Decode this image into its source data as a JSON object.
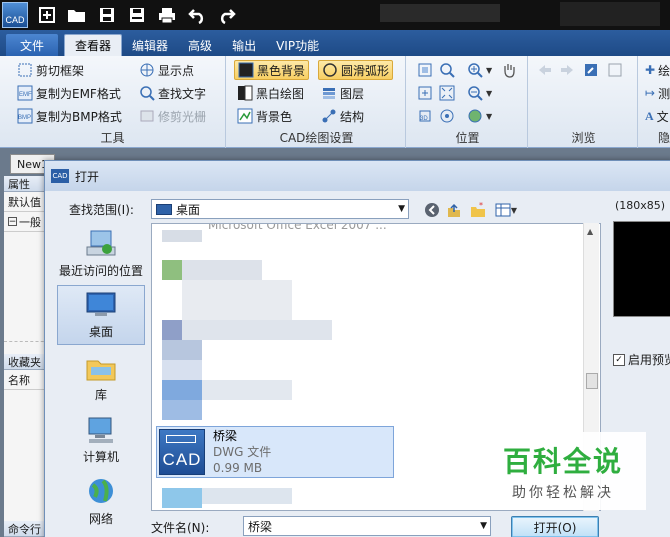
{
  "app": {
    "logo_text": "CAD"
  },
  "ribbon_tabs": [
    {
      "label": "文件"
    },
    {
      "label": "查看器"
    },
    {
      "label": "编辑器"
    },
    {
      "label": "高级"
    },
    {
      "label": "输出"
    },
    {
      "label": "VIP功能"
    }
  ],
  "ribbon": {
    "tools": {
      "label": "工具",
      "buttons": [
        "剪切框架",
        "复制为EMF格式",
        "复制为BMP格式",
        "显示点",
        "查找文字",
        "修剪光栅"
      ]
    },
    "cad_settings": {
      "label": "CAD绘图设置",
      "buttons": [
        "黑色背景",
        "圆滑弧形",
        "黑白绘图",
        "图层",
        "背景色",
        "结构"
      ]
    },
    "position": {
      "label": "位置"
    },
    "browse": {
      "label": "浏览"
    },
    "hidden": {
      "label": "隐",
      "buttons": [
        "绘",
        "测",
        "文"
      ]
    }
  },
  "workspace": {
    "doc_tab": "New1",
    "left_panel": {
      "header": "属性",
      "row1": "默认值",
      "row2": "一般",
      "header2": "收藏夹",
      "col": "名称",
      "bottom": "命令行"
    }
  },
  "dialog": {
    "title": "打开",
    "look_in_label": "查找范围(I):",
    "look_in_value": "桌面",
    "places": [
      "最近访问的位置",
      "桌面",
      "库",
      "计算机",
      "网络"
    ],
    "top_file_partial": "Microsoft Office Excel 2007 ...",
    "selected_file": {
      "name": "桥梁",
      "type": "DWG 文件",
      "size": "0.99 MB",
      "icon_text": "CAD"
    },
    "preview_size": "(180x85)",
    "enable_preview": "启用预览",
    "file_name_label": "文件名(N):",
    "file_name_value": "桥梁",
    "open_button": "打开(O)"
  },
  "watermark": {
    "title": "百科全说",
    "subtitle": "助你轻松解决"
  }
}
